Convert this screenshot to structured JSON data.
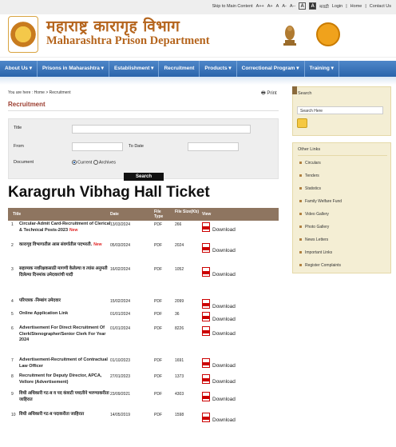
{
  "topbar": {
    "skip": "Skip to Main Content",
    "font_sizes": [
      "A++",
      "A+",
      "A",
      "A-",
      "A--"
    ],
    "contrast": [
      "A",
      "A"
    ],
    "language": "मराठी",
    "login": "Login",
    "home": "Home",
    "contact": "Contact Us"
  },
  "header": {
    "title_marathi": "महाराष्ट्र कारागृह विभाग",
    "title_english": "Maharashtra Prison Department"
  },
  "nav": {
    "items": [
      "About Us",
      "Prisons in Maharashtra",
      "Establishment",
      "Recruitment",
      "Products",
      "Correctional Program",
      "Training"
    ]
  },
  "breadcrumb": {
    "text": "You are here : Home > Recruitment"
  },
  "print_label": "Print",
  "page_title": "Recruitment",
  "filter": {
    "title_label": "Title",
    "from_label": "From",
    "to_label": "To Date",
    "document_label": "Document",
    "current_label": "Current",
    "archives_label": "Archives",
    "search_button": "Search"
  },
  "overlay_title": "Karagruh Vibhag Hall Ticket",
  "table": {
    "headers": {
      "title": "Title",
      "date": "Date",
      "type": "File Type",
      "size": "File Size(Kb)",
      "view": "View"
    },
    "download_label": "Download",
    "new_label": "New",
    "rows": [
      {
        "num": "1",
        "title": "Circular-Admit Card-Recruitment of Clerical & Technical Posts-2023",
        "new": true,
        "date": "13/03/2024",
        "type": "PDF",
        "size": "266"
      },
      {
        "num": "2",
        "title": "कारागृह विभागातील आस संवर्गातील पदभरती.",
        "new": true,
        "date": "05/03/2024",
        "type": "PDF",
        "size": "2024"
      },
      {
        "num": "3",
        "title": "सहाय्यक नवरिक्षकसाठी मागणी केलेल्या व त्यांस अनुमती दिलेल्या दिनमांक उमेदवारांची यादी",
        "new": false,
        "date": "16/02/2024",
        "type": "PDF",
        "size": "1052"
      },
      {
        "num": "4",
        "title": "परिपत्रक -निम्बांग उमेदवार",
        "new": false,
        "date": "15/02/2024",
        "type": "PDF",
        "size": "2099"
      },
      {
        "num": "5",
        "title": "Online Application Link",
        "new": false,
        "date": "01/01/2024",
        "type": "PDF",
        "size": "36"
      },
      {
        "num": "6",
        "title": "Advertisement For Direct Recruitment Of Clerk/Stenographer/Senior Clerk For Year 2024",
        "new": false,
        "date": "01/01/2024",
        "type": "PDF",
        "size": "8226"
      },
      {
        "num": "7",
        "title": "Advertisement-Recruitment of Contractual Law Officer",
        "new": false,
        "date": "01/10/2023",
        "type": "PDF",
        "size": "1691"
      },
      {
        "num": "8",
        "title": "Recruitment for Deputy Director, APCA, Vellore (Advertisement)",
        "new": false,
        "date": "27/01/2023",
        "type": "PDF",
        "size": "1373"
      },
      {
        "num": "9",
        "title": "विधी अधिकारी गट-ब व पद कंत्राटी पध्दतीने भरण्याकरीता जाहिरात",
        "new": false,
        "date": "23/09/2021",
        "type": "PDF",
        "size": "4303"
      },
      {
        "num": "10",
        "title": "विधी अधिकारी गट-ब पदाकरीता जाहिरात",
        "new": false,
        "date": "14/05/2019",
        "type": "PDF",
        "size": "1598"
      }
    ]
  },
  "sidebar": {
    "search_header": "Search",
    "search_placeholder": "Search Here",
    "other_links_header": "Other Links",
    "links": [
      "Circulars",
      "Tenders",
      "Statistics",
      "Family Welfare Fund",
      "Video Gallery",
      "Photo Gallery",
      "News Letters",
      "Important Links",
      "Register Complaints"
    ]
  }
}
